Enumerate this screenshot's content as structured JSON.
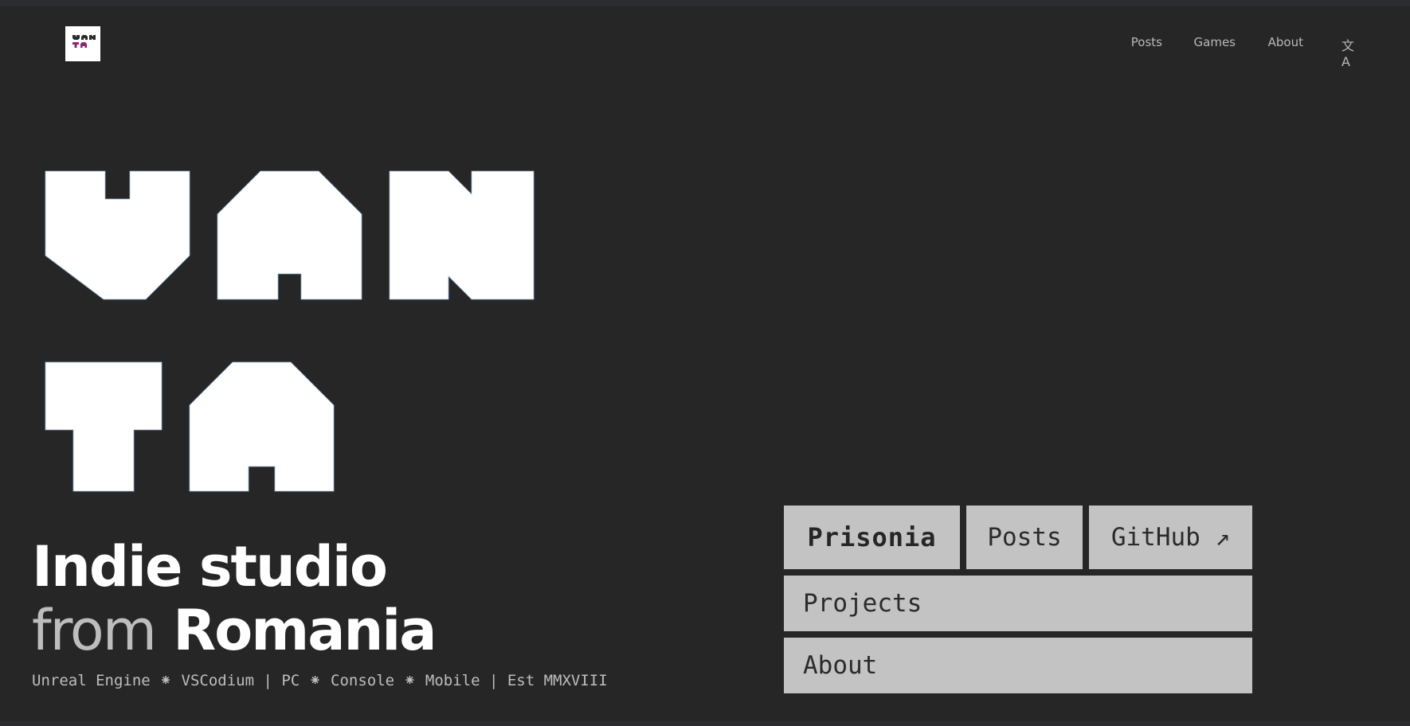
{
  "header": {
    "logo_text": "VANTA",
    "nav": [
      {
        "label": "Posts"
      },
      {
        "label": "Games"
      },
      {
        "label": "About"
      }
    ],
    "language_icon": "文A"
  },
  "hero": {
    "wordmark": "VANTA",
    "headline_line1": "Indie studio",
    "headline_from": "from",
    "headline_place": "Romania",
    "tagline": "Unreal Engine ⁕ VSCodium | PC ⁕ Console ⁕ Mobile | Est MMXVIII"
  },
  "buttons": {
    "prisonia": "Prisonia",
    "posts": "Posts",
    "github": "GitHub ↗",
    "projects": "Projects",
    "about": "About"
  },
  "colors": {
    "background": "#262626",
    "button_bg": "#c3c3c3",
    "button_text": "#2b2b2b",
    "nav_text": "#b9b9b9",
    "logo_accent": "#8a2a6e"
  }
}
